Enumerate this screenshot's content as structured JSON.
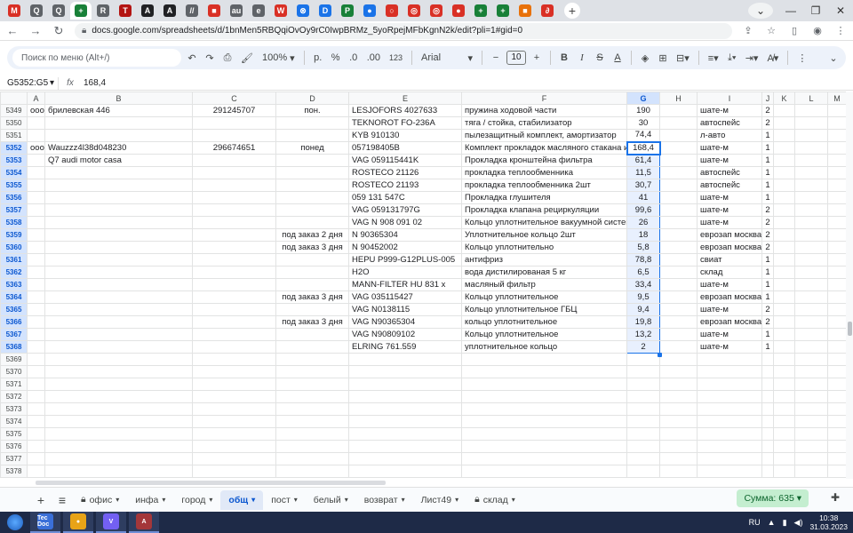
{
  "browser": {
    "tabs": [
      {
        "icon": "M",
        "color": "#d93025"
      },
      {
        "icon": "Q",
        "color": "#5f6368"
      },
      {
        "icon": "Q",
        "color": "#5f6368"
      },
      {
        "icon": "+",
        "color": "#188038",
        "active": true
      },
      {
        "icon": "R",
        "color": "#5f6368"
      },
      {
        "icon": "T",
        "color": "#b31412"
      },
      {
        "icon": "A",
        "color": "#202124"
      },
      {
        "icon": "A",
        "color": "#202124"
      },
      {
        "icon": "//",
        "color": "#5f6368"
      },
      {
        "icon": "■",
        "color": "#d93025"
      },
      {
        "icon": "au",
        "color": "#5f6368"
      },
      {
        "icon": "e",
        "color": "#5f6368"
      },
      {
        "icon": "W",
        "color": "#d93025"
      },
      {
        "icon": "⊗",
        "color": "#1a73e8"
      },
      {
        "icon": "D",
        "color": "#1a73e8"
      },
      {
        "icon": "P",
        "color": "#188038"
      },
      {
        "icon": "●",
        "color": "#1a73e8"
      },
      {
        "icon": "○",
        "color": "#d93025"
      },
      {
        "icon": "◎",
        "color": "#d93025"
      },
      {
        "icon": "◎",
        "color": "#d93025"
      },
      {
        "icon": "●",
        "color": "#d93025"
      },
      {
        "icon": "+",
        "color": "#188038"
      },
      {
        "icon": "+",
        "color": "#188038"
      },
      {
        "icon": "■",
        "color": "#e8710a"
      },
      {
        "icon": "∂",
        "color": "#d93025"
      }
    ],
    "url": "docs.google.com/spreadsheets/d/1bnMen5RBQqiOvOy9rC0IwpBRMz_5yoRpejMFbKgnN2k/edit?pli=1#gid=0"
  },
  "toolbar": {
    "menu_search": "Поиск по меню (Alt+/)",
    "zoom": "100%",
    "currency": "р.",
    "percent": "%",
    "dec_decrease": ".0",
    "dec_increase": ".00",
    "number_format": "123",
    "font": "Arial",
    "font_size": "10"
  },
  "formula_bar": {
    "name_box": "G5352:G5",
    "value": "168,4"
  },
  "grid": {
    "columns": [
      "A",
      "B",
      "C",
      "D",
      "E",
      "F",
      "G",
      "H",
      "I",
      "J",
      "K",
      "L",
      "M"
    ],
    "selected_column": "G",
    "rows": [
      {
        "n": "5349",
        "a": "ооо",
        "b": "брилевская 446",
        "c": "291245707",
        "d": "пон.",
        "e": "LESJOFORS 4027633",
        "f": "пружина ходовой части",
        "g": "190",
        "i": "шате-м",
        "j": "2"
      },
      {
        "n": "5350",
        "e": "TEKNOROT FO-236A",
        "f": "тяга / стойка, стабилизатор",
        "g": "30",
        "i": "автоспейс",
        "j": "2"
      },
      {
        "n": "5351",
        "e": "KYB 910130",
        "f": "пылезащитный комплект, амортизатор",
        "g": "74,4",
        "i": "л-авто",
        "j": "1"
      },
      {
        "n": "5352",
        "a": "ооо",
        "b": "Wauzzz4l38d048230",
        "c": "296674651",
        "d": "понед",
        "e": "057198405B",
        "f": "Комплект прокладок масляного стакана и ма",
        "g": "168,4",
        "i": "шате-м",
        "j": "1",
        "sel": true
      },
      {
        "n": "5353",
        "b": "Q7 audi motor casa",
        "e": "VAG 059115441K",
        "f": "Прокладка кронштейна фильтра",
        "g": "61,4",
        "i": "шате-м",
        "j": "1",
        "sel": true
      },
      {
        "n": "5354",
        "e": "ROSTECO 21126",
        "f": "прокладка теплообменника",
        "g": "11,5",
        "i": "автоспейс",
        "j": "1",
        "sel": true
      },
      {
        "n": "5355",
        "e": "ROSTECO 21193",
        "f": "прокладка теплообменника 2шт",
        "g": "30,7",
        "i": "автоспейс",
        "j": "1",
        "sel": true
      },
      {
        "n": "5356",
        "e": "059 131 547C",
        "f": "Прокладка глушителя",
        "g": "41",
        "i": "шате-м",
        "j": "1",
        "sel": true
      },
      {
        "n": "5357",
        "e": "VAG 059131797G",
        "f": "Прокладка клапана рециркуляции",
        "g": "99,6",
        "i": "шате-м",
        "j": "2",
        "sel": true
      },
      {
        "n": "5358",
        "e": "VAG N 908 091 02",
        "f": "Кольцо уплотнительное вакуумной системы",
        "g": "26",
        "i": "шате-м",
        "j": "2",
        "sel": true
      },
      {
        "n": "5359",
        "d": "под заказ 2 дня",
        "e": "N 90365304",
        "f": "Уплотнительное кольцо 2шт",
        "g": "18",
        "i": "еврозап москва",
        "j": "2",
        "sel": true
      },
      {
        "n": "5360",
        "d": "под заказ 3 дня",
        "e": "N 90452002",
        "f": "Кольцо уплотнительно",
        "g": "5,8",
        "i": "еврозап москва",
        "j": "2",
        "sel": true
      },
      {
        "n": "5361",
        "e": "HEPU P999-G12PLUS-005",
        "f": "антифриз",
        "g": "78,8",
        "i": "свиат",
        "j": "1",
        "sel": true
      },
      {
        "n": "5362",
        "e": "H2O",
        "f": "вода дистилированая 5 кг",
        "g": "6,5",
        "i": "склад",
        "j": "1",
        "sel": true
      },
      {
        "n": "5363",
        "e": "MANN-FILTER HU 831 x",
        "f": "масляный фильтр",
        "g": "33,4",
        "i": "шате-м",
        "j": "1",
        "sel": true
      },
      {
        "n": "5364",
        "d": "под заказ 3 дня",
        "e": "VAG 035115427",
        "f": "Кольцо уплотнительное",
        "g": "9,5",
        "i": "еврозап москва",
        "j": "1",
        "sel": true
      },
      {
        "n": "5365",
        "e": "VAG N0138115",
        "f": "Кольцо уплотнительное ГБЦ",
        "g": "9,4",
        "i": "шате-м",
        "j": "2",
        "sel": true
      },
      {
        "n": "5366",
        "d": "под заказ 3 дня",
        "e": "VAG N90365304",
        "f": "кольцо уплотнительное",
        "g": "19,8",
        "i": "еврозап москва",
        "j": "2",
        "sel": true
      },
      {
        "n": "5367",
        "e": "VAG N90809102",
        "f": "Кольцо уплотнительное",
        "g": "13,2",
        "i": "шате-м",
        "j": "1",
        "sel": true
      },
      {
        "n": "5368",
        "e": "ELRING 761.559",
        "f": "уплотнительное кольцо",
        "g": "2",
        "i": "шате-м",
        "j": "1",
        "sel": true
      },
      {
        "n": "5369"
      },
      {
        "n": "5370"
      },
      {
        "n": "5371"
      },
      {
        "n": "5372"
      },
      {
        "n": "5373"
      },
      {
        "n": "5374"
      },
      {
        "n": "5375"
      },
      {
        "n": "5376"
      },
      {
        "n": "5377"
      },
      {
        "n": "5378"
      }
    ]
  },
  "sheets": {
    "tabs": [
      {
        "label": "офис",
        "locked": true
      },
      {
        "label": "инфа"
      },
      {
        "label": "город"
      },
      {
        "label": "общ",
        "active": true
      },
      {
        "label": "пост"
      },
      {
        "label": "белый"
      },
      {
        "label": "возврат"
      },
      {
        "label": "Лист49"
      },
      {
        "label": "склад",
        "locked": true
      }
    ],
    "sum": "Сумма: 635"
  },
  "taskbar": {
    "lang": "RU",
    "time": "10:38",
    "date": "31.03.2023",
    "apps": [
      {
        "label": "Tec Doc",
        "color": "#3a6fd8"
      },
      {
        "label": "●",
        "color": "#e8a317"
      },
      {
        "label": "V",
        "color": "#7360f2"
      },
      {
        "label": "A",
        "color": "#a4373a"
      }
    ]
  }
}
